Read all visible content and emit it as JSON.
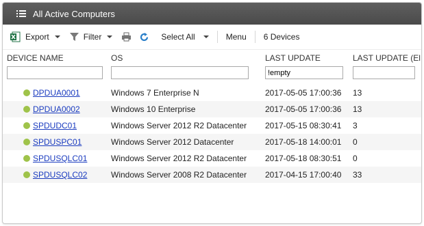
{
  "window": {
    "title": "All Active Computers"
  },
  "toolbar": {
    "export_label": "Export",
    "filter_label": "Filter",
    "select_all_label": "Select All",
    "menu_label": "Menu",
    "device_count": "6 Devices"
  },
  "columns": {
    "device_name": "DEVICE NAME",
    "os": "OS",
    "last_update": "LAST UPDATE",
    "last_update_e": "LAST UPDATE (El"
  },
  "filters": {
    "device_name": "",
    "os": "",
    "last_update": "!empty",
    "last_update_e": ""
  },
  "rows": [
    {
      "name": "DPDUA0001",
      "os": "Windows 7 Enterprise N",
      "last_update": "2017-05-05 17:00:36",
      "elapsed": "13"
    },
    {
      "name": "DPDUA0002",
      "os": "Windows 10 Enterprise",
      "last_update": "2017-05-05 17:00:36",
      "elapsed": "13"
    },
    {
      "name": "SPDUDC01",
      "os": "Windows Server 2012 R2 Datacenter",
      "last_update": "2017-05-15 08:30:41",
      "elapsed": "3"
    },
    {
      "name": "SPDUSPC01",
      "os": "Windows Server 2012 Datacenter",
      "last_update": "2017-05-18 14:00:01",
      "elapsed": "0"
    },
    {
      "name": "SPDUSQLC01",
      "os": "Windows Server 2012 R2 Datacenter",
      "last_update": "2017-05-18 08:30:51",
      "elapsed": "0"
    },
    {
      "name": "SPDUSQLC02",
      "os": "Windows Server 2008 R2 Datacenter",
      "last_update": "2017-04-15 17:00:40",
      "elapsed": "33"
    }
  ],
  "colors": {
    "status_online": "#9fc34a",
    "titlebar": "#4f4f4f",
    "link": "#1a3bbf",
    "excel": "#1f7244",
    "refresh": "#2a7fc9"
  },
  "icons": {
    "title": "list-icon",
    "export": "excel-icon",
    "filter": "funnel-icon",
    "print": "printer-icon",
    "refresh": "refresh-icon"
  }
}
